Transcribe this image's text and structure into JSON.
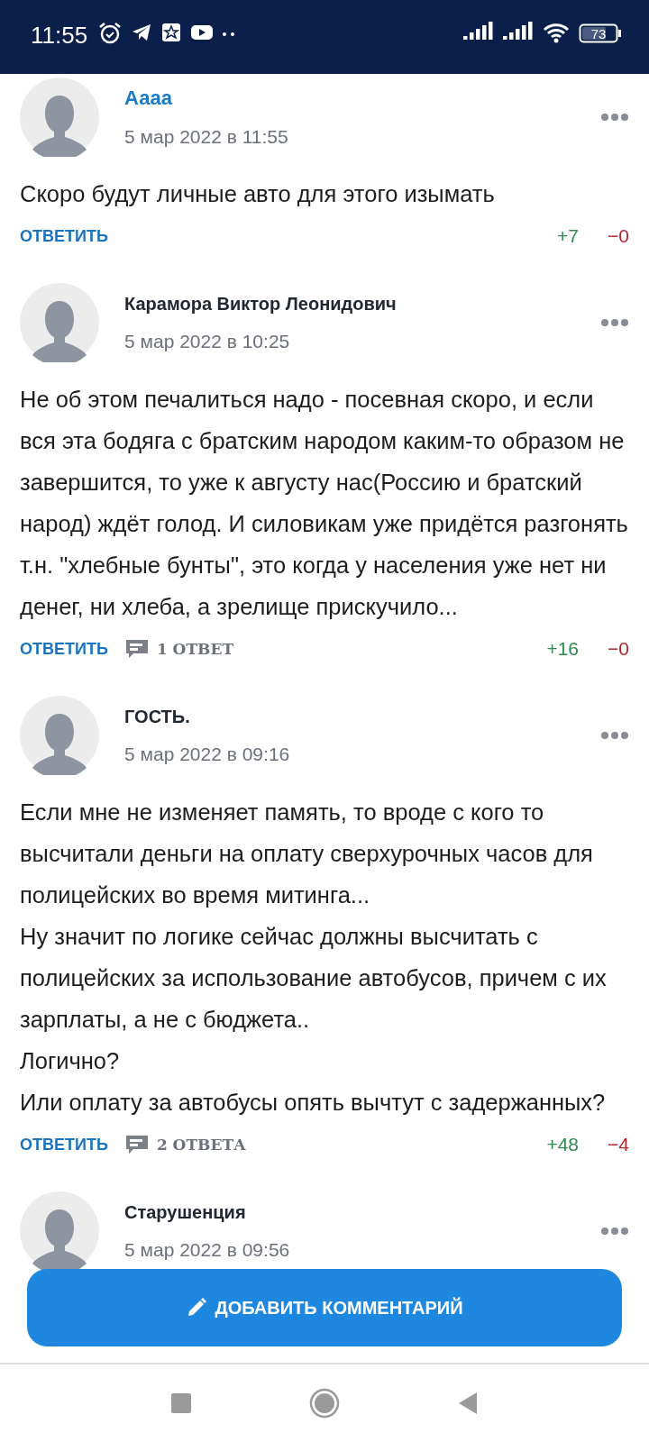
{
  "status_bar": {
    "time": "11:55",
    "battery": "73"
  },
  "comments": [
    {
      "author": "Аааа",
      "author_highlighted": true,
      "date": "5 мар 2022 в 11:55",
      "text": "Скоро будут личные авто для этого изымать",
      "reply": "ОТВЕТИТЬ",
      "up": "+7",
      "down": "−0"
    },
    {
      "author": "Карамора Виктор Леонидович",
      "author_highlighted": false,
      "date": "5 мар 2022 в 10:25",
      "text": "Не об этом печалиться надо - посевная скоро, и если вся эта бодяга с братским народом каким-то образом не завершится, то уже к августу нас(Россию и братский народ) ждёт голод. И силовикам уже придётся разгонять т.н. \"хлебные бунты\", это когда у населения уже нет ни денег, ни хлеба, а зрелище прискучило...",
      "reply": "ОТВЕТИТЬ",
      "replies": "1 ОТВЕТ",
      "up": "+16",
      "down": "−0"
    },
    {
      "author": "ГОСТЬ.",
      "author_highlighted": false,
      "date": "5 мар 2022 в 09:16",
      "text": "Если мне не изменяет память, то вроде с кого то высчитали деньги на оплату сверхурочных часов для полицейских во время митинга...\nНу значит по логике сейчас должны высчитать с полицейских за использование автобусов, причем с их зарплаты, а не с бюджета..\nЛогично?\nИли оплату за автобусы опять вычтут с задержанных?",
      "reply": "ОТВЕТИТЬ",
      "replies": "2 ОТВЕТА",
      "up": "+48",
      "down": "−4"
    },
    {
      "author": "Старушенция",
      "author_highlighted": false,
      "date": "5 мар 2022 в 09:56"
    }
  ],
  "add_button": "ДОБАВИТЬ КОММЕНТАРИЙ"
}
